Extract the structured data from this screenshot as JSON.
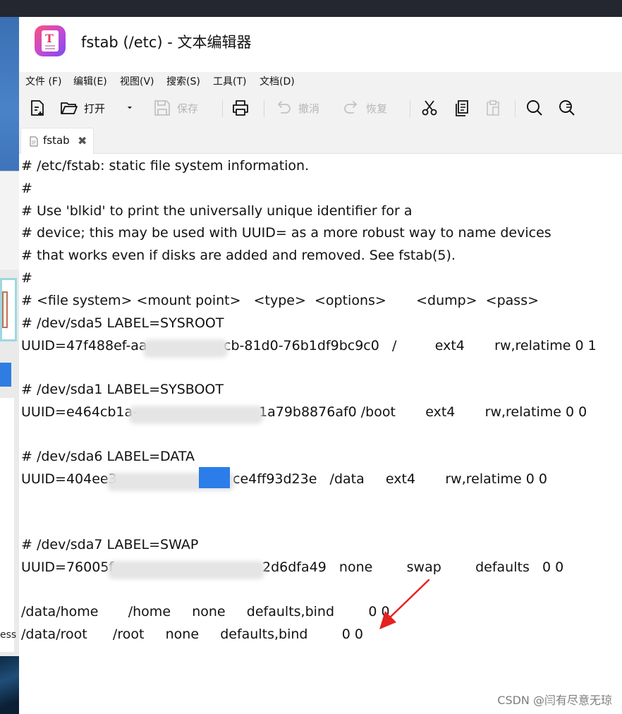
{
  "window": {
    "title": "fstab (/etc) - 文本编辑器",
    "app_icon_letter": "T"
  },
  "menu": [
    "文件 (F)",
    "编辑(E)",
    "视图(V)",
    "搜索(S)",
    "工具(T)",
    "文档(D)"
  ],
  "toolbar": {
    "open_label": "打开",
    "save_label": "保存",
    "undo_label": "撤消",
    "redo_label": "恢复"
  },
  "tab": {
    "label": "fstab",
    "close": "✖"
  },
  "lines": [
    "# /etc/fstab: static file system information.",
    "#",
    "# Use 'blkid' to print the universally unique identifier for a",
    "# device; this may be used with UUID= as a more robust way to name devices",
    "# that works even if disks are added and removed. See fstab(5).",
    "#",
    "# <file system> <mount point>   <type>  <options>       <dump>  <pass>",
    "# /dev/sda5 LABEL=SYSROOT",
    "UUID=47f488ef-aa",
    "# /dev/sda1 LABEL=SYSBOOT",
    "UUID=e464cb1a-",
    "# /dev/sda6 LABEL=DATA",
    "UUID=404ee3",
    "# /dev/sda7 LABEL=SWAP",
    "UUID=76005f",
    "/data/home       /home     none     defaults,bind        0 0",
    "/data/root      /root     none     defaults,bind        0 0"
  ],
  "uuid_tails": {
    "sysroot": "cb-81d0-76b1df9bc9c0   /         ext4       rw,relatime 0 1",
    "sysboot": "1a79b8876af0 /boot       ext4       rw,relatime 0 0",
    "data": "ce4ff93d23e   /data     ext4       rw,relatime 0 0",
    "swap": "2d6dfa49   none        swap        defaults   0 0"
  },
  "background": {
    "fragment_text": "ess"
  },
  "watermark": "CSDN @闫有尽意无琼"
}
